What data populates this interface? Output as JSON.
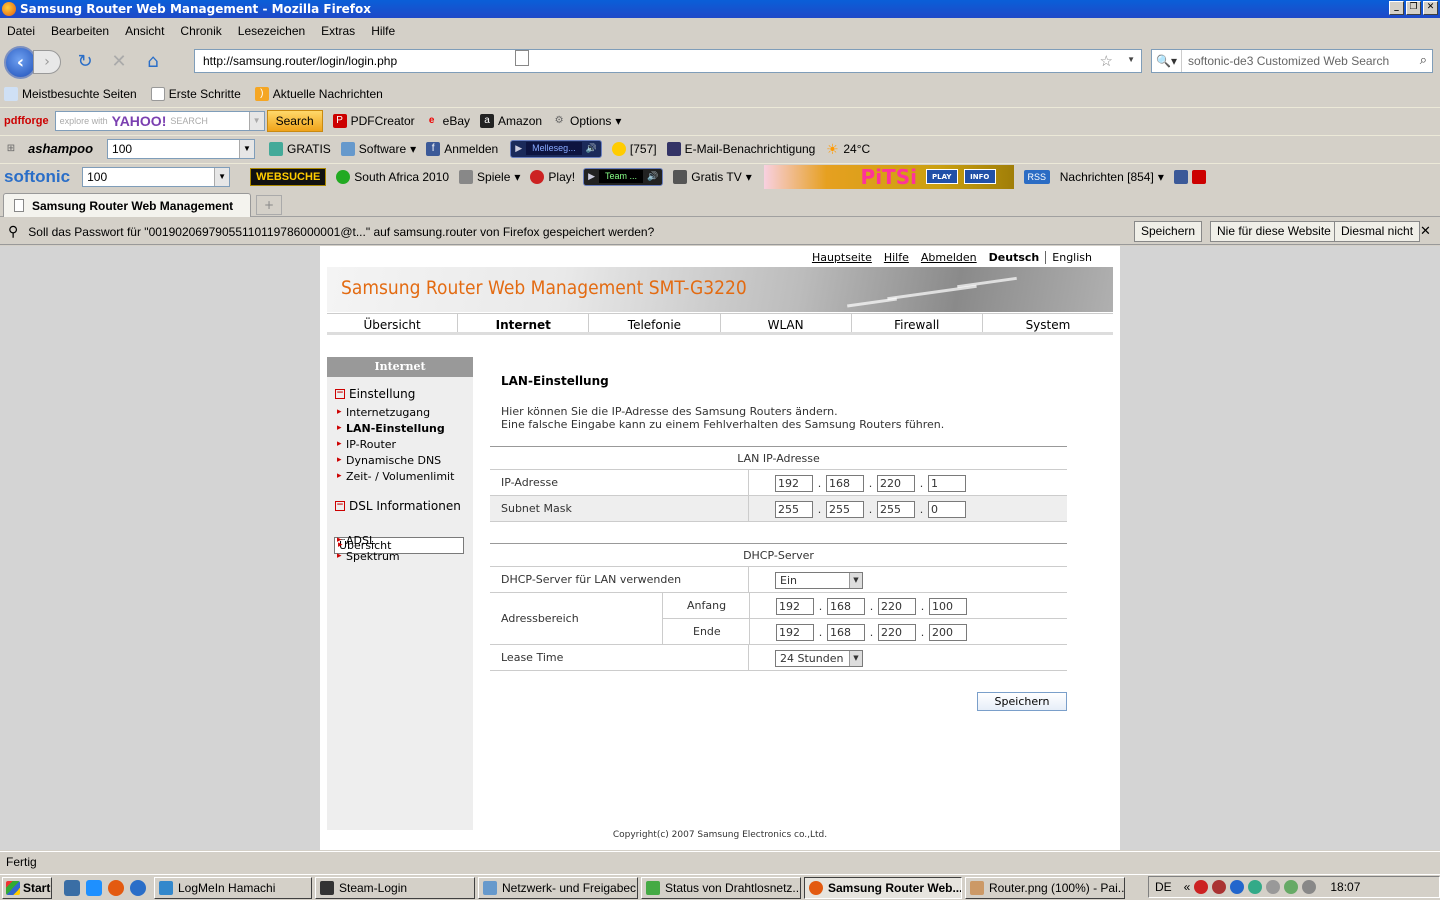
{
  "window": {
    "title": "Samsung Router Web Management - Mozilla Firefox"
  },
  "menu": [
    "Datei",
    "Bearbeiten",
    "Ansicht",
    "Chronik",
    "Lesezeichen",
    "Extras",
    "Hilfe"
  ],
  "nav": {
    "url": "http://samsung.router/login/login.php",
    "search_placeholder": "softonic-de3 Customized Web Search"
  },
  "bookmarks": [
    "Meistbesuchte Seiten",
    "Erste Schritte",
    "Aktuelle Nachrichten"
  ],
  "toolbar1": {
    "brand": "pdfforge",
    "yahoo_hint": "explore with",
    "yahoo_logo": "YAHOO!",
    "yahoo_search": "SEARCH",
    "search_btn": "Search",
    "pdfcreator": "PDFCreator",
    "ebay": "eBay",
    "amazon": "Amazon",
    "options": "Options"
  },
  "toolbar2": {
    "brand": "ashampoo",
    "field": "100",
    "gratis": "GRATIS",
    "software": "Software",
    "anmelden": "Anmelden",
    "player": "Melleseg...",
    "count": "[757]",
    "email": "E-Mail-Benachrichtigung",
    "temp": "24°C"
  },
  "toolbar3": {
    "brand": "softonic",
    "field": "100",
    "websuche": "WEBSUCHE",
    "southafrica": "South Africa 2010",
    "spiele": "Spiele",
    "play": "Play!",
    "player": "Team ...",
    "gratistv": "Gratis TV",
    "pitsi": "PiTSi",
    "pitsi_play": "PLAY",
    "pitsi_info": "INFO",
    "rss": "RSS",
    "nachrichten": "Nachrichten [854]"
  },
  "tab": {
    "title": "Samsung Router Web Management",
    "new_tab": "+"
  },
  "notification": {
    "text": "Soll das Passwort für \"00190206979055110119786000001@t...\" auf samsung.router von Firefox gespeichert werden?",
    "save": "Speichern",
    "never": "Nie für diese Website",
    "not_now": "Diesmal nicht"
  },
  "router": {
    "toplinks": [
      "Hauptseite",
      "Hilfe",
      "Abmelden",
      "Deutsch",
      "English"
    ],
    "banner_title": "Samsung Router Web Management  SMT-G3220",
    "tabs": [
      "Übersicht",
      "Internet",
      "Telefonie",
      "WLAN",
      "Firewall",
      "System"
    ],
    "sidebar": {
      "header": "Internet",
      "group1": "Einstellung",
      "items1": [
        "Internetzugang",
        "LAN-Einstellung",
        "IP-Router",
        "Dynamische DNS",
        "Zeit- / Volumenlimit"
      ],
      "group2": "DSL Informationen",
      "items2": [
        "Übersicht",
        "ADSL",
        "Spektrum"
      ]
    },
    "heading": "LAN-Einstellung",
    "desc1": "Hier können Sie die IP-Adresse des Samsung Routers ändern.",
    "desc2": "Eine falsche Eingabe kann zu einem Fehlverhalten des Samsung Routers führen.",
    "lan": {
      "section": "LAN IP-Adresse",
      "ip_label": "IP-Adresse",
      "ip": [
        "192",
        "168",
        "220",
        "1"
      ],
      "mask_label": "Subnet Mask",
      "mask": [
        "255",
        "255",
        "255",
        "0"
      ]
    },
    "dhcp": {
      "section": "DHCP-Server",
      "enable_label": "DHCP-Server für LAN verwenden",
      "enable_value": "Ein",
      "range_label": "Adressbereich",
      "start_label": "Anfang",
      "start": [
        "192",
        "168",
        "220",
        "100"
      ],
      "end_label": "Ende",
      "end": [
        "192",
        "168",
        "220",
        "200"
      ],
      "lease_label": "Lease Time",
      "lease_value": "24 Stunden"
    },
    "save": "Speichern",
    "copyright": "Copyright(c) 2007 Samsung Electronics co.,Ltd."
  },
  "status": "Fertig",
  "taskbar": {
    "start": "Start",
    "tasks": [
      "LogMeIn Hamachi",
      "Steam-Login",
      "Netzwerk- und Freigabec...",
      "Status von Drahtlosnetz...",
      "Samsung Router Web...",
      "Router.png (100%) - Pai..."
    ],
    "lang": "DE",
    "clock": "18:07"
  }
}
